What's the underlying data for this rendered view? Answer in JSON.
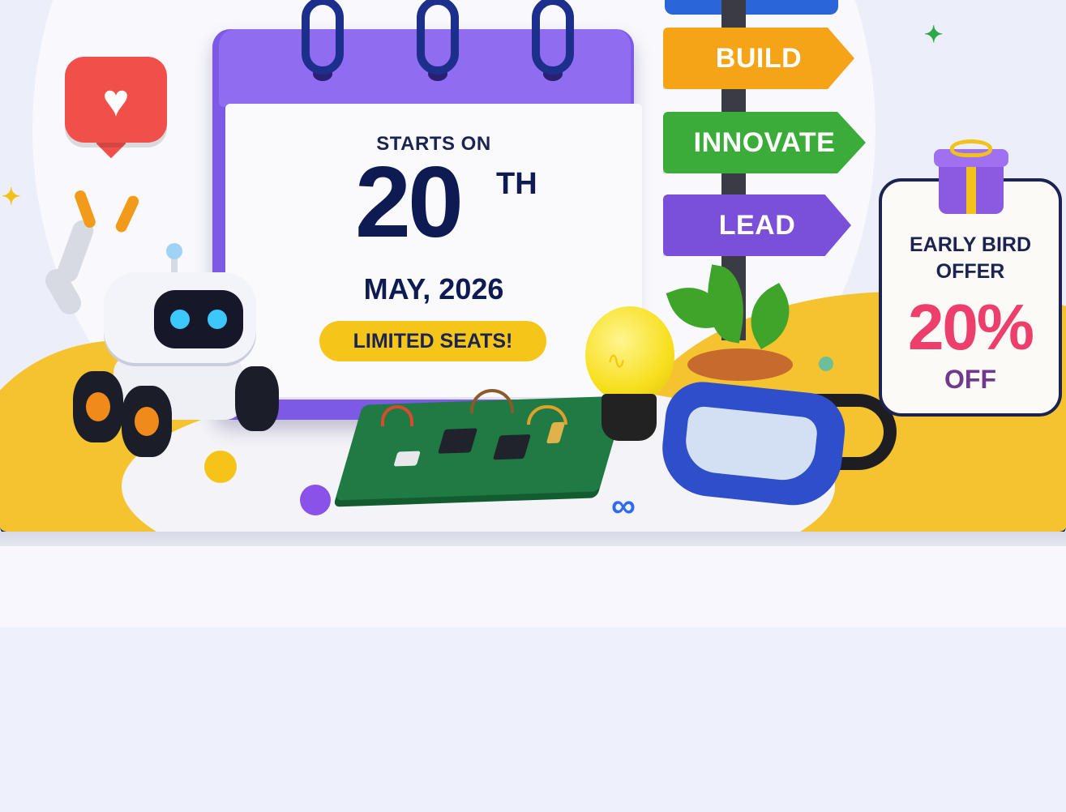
{
  "banner": {
    "calendar": {
      "starts_label": "STARTS ON",
      "day": "20",
      "day_suffix": "TH",
      "month_year": "MAY, 2026",
      "badge": "LIMITED SEATS!"
    },
    "signs": [
      {
        "label": "BUILD",
        "color": "#f5a418"
      },
      {
        "label": "INNOVATE",
        "color": "#3bab3a"
      },
      {
        "label": "LEAD",
        "color": "#7a4fd9"
      }
    ],
    "offer": {
      "title": "EARLY BIRD OFFER",
      "percent": "20%",
      "suffix": "OFF"
    }
  },
  "colors": {
    "calendar_purple": "#8f6cf0",
    "accent_yellow": "#f6c330",
    "navy": "#0e1a52",
    "offer_pink": "#ec3f6b"
  },
  "icons": [
    "heart-icon",
    "robot-illustration",
    "light-bulb-icon",
    "goggles-illustration",
    "circuit-board-illustration",
    "gift-icon",
    "sparkle-icon"
  ]
}
